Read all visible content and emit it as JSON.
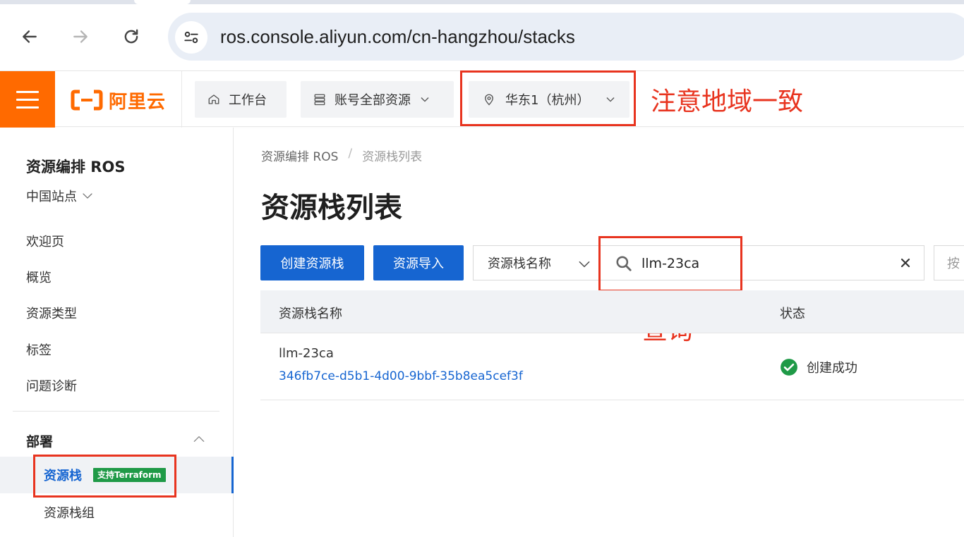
{
  "browser": {
    "url": "ros.console.aliyun.com/cn-hangzhou/stacks"
  },
  "topbar": {
    "logo_text": "阿里云",
    "workbench": "工作台",
    "all_resources": "账号全部资源",
    "region": "华东1（杭州）",
    "accent_color": "#ff6a00"
  },
  "annotations": {
    "region_note": "注意地域一致",
    "search_note": "查询",
    "color": "#e8341f"
  },
  "sidebar": {
    "title": "资源编排 ROS",
    "site": "中国站点",
    "items": [
      "欢迎页",
      "概览",
      "资源类型",
      "标签",
      "问题诊断"
    ],
    "group": "部署",
    "active_item": "资源栈",
    "active_badge": "支持Terraform",
    "sub_item": "资源栈组"
  },
  "main": {
    "breadcrumb": [
      "资源编排 ROS",
      "资源栈列表"
    ],
    "title": "资源栈列表",
    "create_button": "创建资源栈",
    "import_button": "资源导入",
    "filter_field": "资源栈名称",
    "search_value": "llm-23ca",
    "next_filter": "按",
    "columns": [
      "资源栈名称",
      "状态"
    ],
    "rows": [
      {
        "name": "llm-23ca",
        "id": "346fb7ce-d5b1-4d00-9bbf-35b8ea5cef3f",
        "status": "创建成功"
      }
    ]
  }
}
